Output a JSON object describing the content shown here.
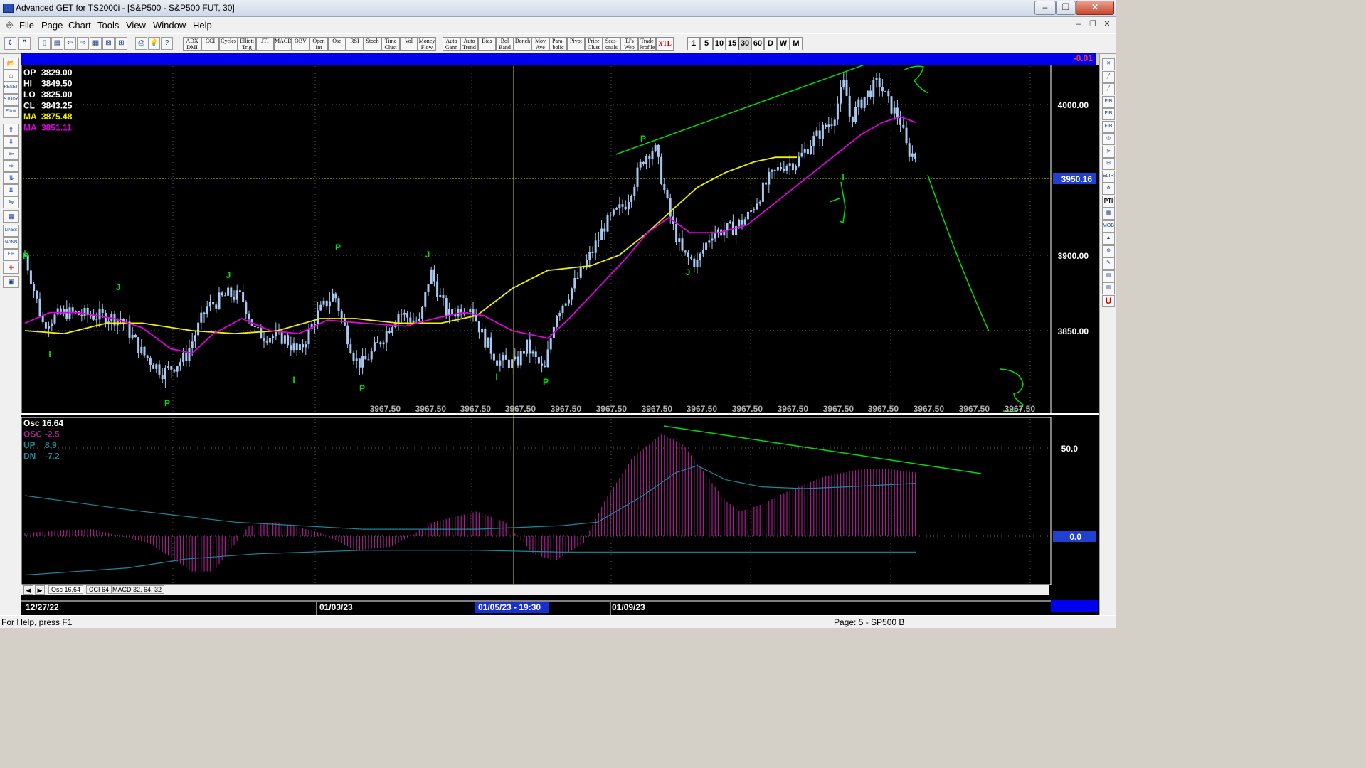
{
  "window": {
    "title": "Advanced GET for TS2000i - [S&P500 - S&P500 FUT, 30]",
    "controls": [
      "–",
      "❐",
      "✕"
    ],
    "mdi_controls": [
      "–",
      "❐",
      "✕"
    ]
  },
  "menu": [
    "File",
    "Page",
    "Chart",
    "Tools",
    "View",
    "Window",
    "Help"
  ],
  "toolbar": {
    "indicator_buttons": [
      "ADX DMI",
      "CCI",
      "Cycles",
      "Elliott Trig",
      "JTI",
      "MACD",
      "OBV",
      "Open Int",
      "Osc",
      "RSI",
      "Stoch",
      "Time Clust",
      "Vol",
      "Money Flow"
    ],
    "study_buttons": [
      "Auto Gann",
      "Auto Trend",
      "Bias",
      "Bol Band",
      "Donch",
      "Mov Ave",
      "Para- bolic",
      "Pivot",
      "Price Clust",
      "Seas- onals",
      "TJ's Web",
      "Trade Profile",
      "XTL"
    ],
    "intervals": [
      "1",
      "5",
      "10",
      "15",
      "30",
      "60",
      "D",
      "W",
      "M"
    ]
  },
  "left_toolbar_labels": [
    "",
    "",
    "RESET",
    "STUDY",
    "Elliott",
    "",
    "",
    "",
    "",
    "",
    "",
    "",
    "",
    "LINES",
    "GANN",
    "FIB",
    "",
    ""
  ],
  "right_toolbar_labels": [
    "",
    "",
    "",
    "FIB RET",
    "FIB EXT",
    "FIB TIME",
    "",
    "",
    "",
    "ELIPS",
    "",
    "PTI",
    "",
    "MOB",
    "",
    "",
    "",
    "",
    "",
    "U"
  ],
  "colors": {
    "background": "#000000",
    "candle": "#a8c8f0",
    "ma_yellow": "#f0f000",
    "ma_magenta": "#e000e0",
    "annotation_green": "#00e000",
    "osc_bars": "#a0208a",
    "osc_line": "#1b8a9a",
    "blue_bar": "#0000ee"
  },
  "top_bar_value": "-0.01",
  "price_panel": {
    "readouts": [
      {
        "label": "OP",
        "value": "3829.00",
        "color": "#ffffff"
      },
      {
        "label": "HI",
        "value": "3849.50",
        "color": "#ffffff"
      },
      {
        "label": "LO",
        "value": "3825.00",
        "color": "#ffffff"
      },
      {
        "label": "CL",
        "value": "3843.25",
        "color": "#ffffff"
      },
      {
        "label": "MA",
        "value": "3875.48",
        "color": "#f0f000"
      },
      {
        "label": "MA",
        "value": "3851.11",
        "color": "#e000e0"
      }
    ],
    "price_ticks": [
      "4000.00",
      "3900.00",
      "3850.00"
    ],
    "cursor_price": "3950.16",
    "bottom_value_label": "3967.50",
    "bottom_labels_count_note": "repeated",
    "wave_labels": [
      {
        "text": "P",
        "pos": "low"
      },
      {
        "text": "J",
        "pos": "high"
      },
      {
        "text": "I",
        "pos": "low"
      }
    ]
  },
  "osc_panel": {
    "readouts": [
      {
        "label": "Osc 16,64",
        "value": "",
        "color": "#ffffff"
      },
      {
        "label": "OSC",
        "value": "-2.5",
        "color": "#a0208a"
      },
      {
        "label": "UP",
        "value": "8.9",
        "color": "#1b8a9a"
      },
      {
        "label": "DN",
        "value": "-7.2",
        "color": "#1b8a9a"
      }
    ],
    "ticks": [
      "50.0",
      "0.0"
    ],
    "tabs": [
      "Osc 16,64",
      "CCI 64",
      "MACD 32, 64, 32"
    ]
  },
  "time_axis": {
    "labels": [
      "12/27/22",
      "01/03/23",
      "01/05/23 - 19:30",
      "01/09/23"
    ]
  },
  "status": {
    "help": "For Help, press F1",
    "page": "Page: 5 - SP500 B"
  }
}
